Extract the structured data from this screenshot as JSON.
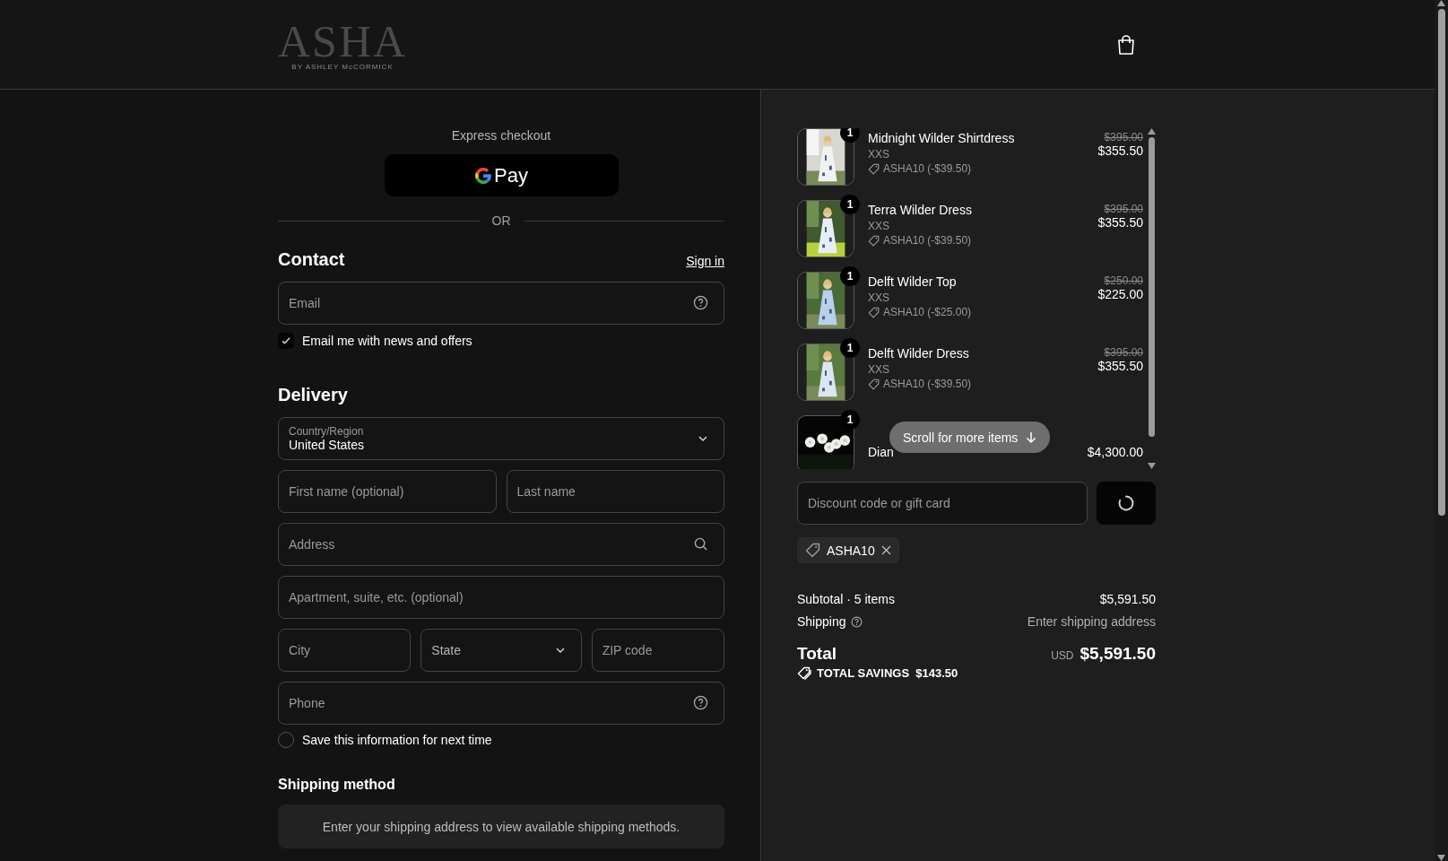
{
  "header": {
    "logo": {
      "title": "ASHA",
      "subtitle": "BY ASHLEY McCORMICK"
    }
  },
  "express_checkout": {
    "label": "Express checkout",
    "button_label": "Pay"
  },
  "divider_label": "OR",
  "contact": {
    "title": "Contact",
    "sign_in": "Sign in",
    "email": {
      "placeholder": "Email",
      "kind": "help"
    },
    "newsletter": {
      "label": "Email me with news and offers",
      "checked": true
    }
  },
  "delivery": {
    "title": "Delivery",
    "country": {
      "label": "Country/Region",
      "value": "United States"
    },
    "rows": [
      [
        {
          "placeholder": "First name (optional)",
          "kind": "text"
        },
        {
          "placeholder": "Last name",
          "kind": "text"
        }
      ],
      [
        {
          "placeholder": "Address",
          "kind": "search"
        }
      ],
      [
        {
          "placeholder": "Apartment, suite, etc. (optional)",
          "kind": "text"
        }
      ],
      [
        {
          "placeholder": "City",
          "kind": "text"
        },
        {
          "placeholder": "State",
          "kind": "select"
        },
        {
          "placeholder": "ZIP code",
          "kind": "text"
        }
      ],
      [
        {
          "placeholder": "Phone",
          "kind": "help"
        }
      ]
    ],
    "save_info": {
      "label": "Save this information for next time",
      "checked": false
    }
  },
  "shipping_method": {
    "title": "Shipping method",
    "message": "Enter your shipping address to view available shipping methods."
  },
  "order": {
    "items": [
      {
        "name": "Midnight Wilder Shirtdress",
        "variant": "XXS",
        "discount": "ASHA10 (-$39.50)",
        "original_price": "$395.00",
        "price": "$355.50",
        "quantity": "1",
        "kind": "picture"
      },
      {
        "name": "Terra Wilder Dress",
        "variant": "XXS",
        "discount": "ASHA10 (-$39.50)",
        "original_price": "$395.00",
        "price": "$355.50",
        "quantity": "1",
        "kind": "picture"
      },
      {
        "name": "Delft Wilder Top",
        "variant": "XXS",
        "discount": "ASHA10 (-$25.00)",
        "original_price": "$250.00",
        "price": "$225.00",
        "quantity": "1",
        "kind": "picture"
      },
      {
        "name": "Delft Wilder Dress",
        "variant": "XXS",
        "discount": "ASHA10 (-$39.50)",
        "original_price": "$395.00",
        "price": "$355.50",
        "quantity": "1",
        "kind": "picture"
      },
      {
        "name": "Dian",
        "price": "$4,300.00",
        "quantity": "1",
        "kind": "picture"
      }
    ],
    "scroll_hint": "Scroll for more items",
    "discount_field": {
      "placeholder": "Discount code or gift card"
    },
    "applied_codes": [
      {
        "code": "ASHA10"
      }
    ],
    "subtotal": {
      "label": "Subtotal · 5 items",
      "value": "$5,591.50"
    },
    "shipping": {
      "label": "Shipping",
      "value": "Enter shipping address"
    },
    "total": {
      "label": "Total",
      "currency": "USD",
      "value": "$5,591.50"
    },
    "savings": {
      "label": "TOTAL SAVINGS",
      "value": "$143.50"
    }
  }
}
